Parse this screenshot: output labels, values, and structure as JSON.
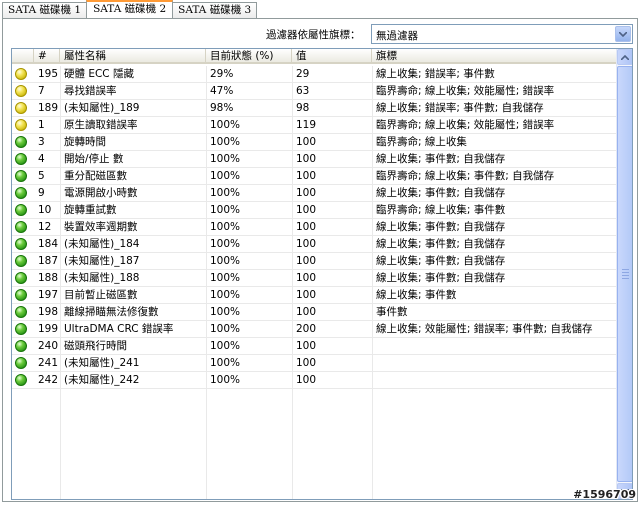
{
  "tabs": [
    "SATA 磁碟機 1",
    "SATA 磁碟機 2",
    "SATA 磁碟機 3"
  ],
  "active_tab": 1,
  "filter": {
    "label": "過濾器依屬性旗標：",
    "value": "無過濾器"
  },
  "columns": {
    "status": "",
    "id": "#",
    "name": "屬性名稱",
    "current": "目前狀態 (%)",
    "value": "值",
    "flags": "旗標"
  },
  "status_colors": {
    "yellow": "#e8d83a",
    "green": "#3cab22"
  },
  "rows": [
    {
      "status": "yellow",
      "id": "195",
      "name": "硬體 ECC 隱藏",
      "current": "29%",
      "value": "29",
      "flags": "線上收集; 錯誤率; 事件數"
    },
    {
      "status": "yellow",
      "id": "7",
      "name": "尋找錯誤率",
      "current": "47%",
      "value": "63",
      "flags": "臨界壽命; 線上收集; 效能屬性; 錯誤率"
    },
    {
      "status": "yellow",
      "id": "189",
      "name": "(未知屬性)_189",
      "current": "98%",
      "value": "98",
      "flags": "線上收集; 錯誤率; 事件數; 自我儲存"
    },
    {
      "status": "yellow",
      "id": "1",
      "name": "原生讀取錯誤率",
      "current": "100%",
      "value": "119",
      "flags": "臨界壽命; 線上收集; 效能屬性; 錯誤率"
    },
    {
      "status": "green",
      "id": "3",
      "name": "旋轉時間",
      "current": "100%",
      "value": "100",
      "flags": "臨界壽命; 線上收集"
    },
    {
      "status": "green",
      "id": "4",
      "name": "開始/停止 數",
      "current": "100%",
      "value": "100",
      "flags": "線上收集; 事件數; 自我儲存"
    },
    {
      "status": "green",
      "id": "5",
      "name": "重分配磁區數",
      "current": "100%",
      "value": "100",
      "flags": "臨界壽命; 線上收集; 事件數; 自我儲存"
    },
    {
      "status": "green",
      "id": "9",
      "name": "電源開啟小時數",
      "current": "100%",
      "value": "100",
      "flags": "線上收集; 事件數; 自我儲存"
    },
    {
      "status": "green",
      "id": "10",
      "name": "旋轉重試數",
      "current": "100%",
      "value": "100",
      "flags": "臨界壽命; 線上收集; 事件數"
    },
    {
      "status": "green",
      "id": "12",
      "name": "裝置效率週期數",
      "current": "100%",
      "value": "100",
      "flags": "線上收集; 事件數; 自我儲存"
    },
    {
      "status": "green",
      "id": "184",
      "name": "(未知屬性)_184",
      "current": "100%",
      "value": "100",
      "flags": "線上收集; 事件數; 自我儲存"
    },
    {
      "status": "green",
      "id": "187",
      "name": "(未知屬性)_187",
      "current": "100%",
      "value": "100",
      "flags": "線上收集; 事件數; 自我儲存"
    },
    {
      "status": "green",
      "id": "188",
      "name": "(未知屬性)_188",
      "current": "100%",
      "value": "100",
      "flags": "線上收集; 事件數; 自我儲存"
    },
    {
      "status": "green",
      "id": "197",
      "name": "目前暫止磁區數",
      "current": "100%",
      "value": "100",
      "flags": "線上收集; 事件數"
    },
    {
      "status": "green",
      "id": "198",
      "name": "離線掃瞄無法修復數",
      "current": "100%",
      "value": "100",
      "flags": "事件數"
    },
    {
      "status": "green",
      "id": "199",
      "name": "UltraDMA CRC 錯誤率",
      "current": "100%",
      "value": "200",
      "flags": "線上收集; 效能屬性; 錯誤率; 事件數; 自我儲存"
    },
    {
      "status": "green",
      "id": "240",
      "name": "磁頭飛行時間",
      "current": "100%",
      "value": "100",
      "flags": ""
    },
    {
      "status": "green",
      "id": "241",
      "name": "(未知屬性)_241",
      "current": "100%",
      "value": "100",
      "flags": ""
    },
    {
      "status": "green",
      "id": "242",
      "name": "(未知屬性)_242",
      "current": "100%",
      "value": "100",
      "flags": ""
    }
  ],
  "watermark": "#1596709"
}
